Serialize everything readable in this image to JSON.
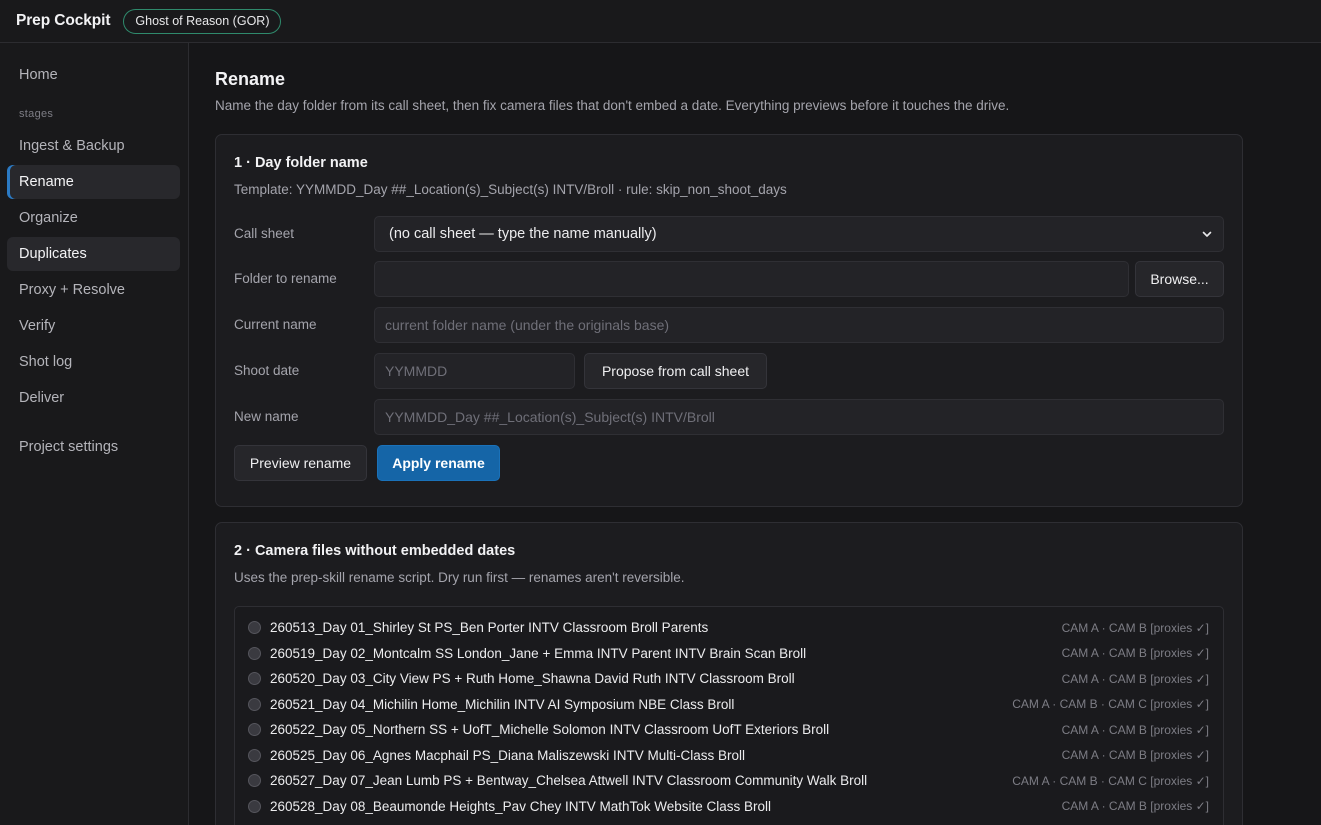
{
  "app": {
    "title": "Prep Cockpit",
    "project": "Ghost of Reason (GOR)"
  },
  "sidebar": {
    "home": "Home",
    "group_label": "stages",
    "items": [
      {
        "label": "Ingest & Backup"
      },
      {
        "label": "Rename"
      },
      {
        "label": "Organize"
      },
      {
        "label": "Duplicates"
      },
      {
        "label": "Proxy + Resolve"
      },
      {
        "label": "Verify"
      },
      {
        "label": "Shot log"
      },
      {
        "label": "Deliver"
      }
    ],
    "settings": "Project settings",
    "active": "Rename"
  },
  "page": {
    "title": "Rename",
    "subtitle": "Name the day folder from its call sheet, then fix camera files that don't embed a date. Everything previews before it touches the drive."
  },
  "day_folder": {
    "title": "1 · Day folder name",
    "template": "Template: YYMMDD_Day ##_Location(s)_Subject(s) INTV/Broll · rule: skip_non_shoot_days",
    "call_sheet_label": "Call sheet",
    "call_sheet_value": "(no call sheet — type the name manually)",
    "folder_label": "Folder to rename",
    "folder_value": "",
    "browse_label": "Browse...",
    "current_label": "Current name",
    "current_placeholder": "current folder name (under the originals base)",
    "shoot_date_label": "Shoot date",
    "shoot_date_placeholder": "YYMMDD",
    "propose_label": "Propose from call sheet",
    "new_name_label": "New name",
    "new_name_placeholder": "YYMMDD_Day ##_Location(s)_Subject(s) INTV/Broll",
    "preview_label": "Preview rename",
    "apply_label": "Apply rename"
  },
  "camera_files": {
    "title": "2 · Camera files without embedded dates",
    "subtitle": "Uses the prep-skill rename script. Dry run first — renames aren't reversible.",
    "folders": [
      {
        "name": "260513_Day 01_Shirley St PS_Ben Porter INTV Classroom Broll Parents",
        "meta": "CAM A · CAM B [proxies ✓]"
      },
      {
        "name": "260519_Day 02_Montcalm SS London_Jane + Emma INTV Parent INTV Brain Scan Broll",
        "meta": "CAM A · CAM B [proxies ✓]"
      },
      {
        "name": "260520_Day 03_City View PS + Ruth Home_Shawna David Ruth INTV Classroom Broll",
        "meta": "CAM A · CAM B [proxies ✓]"
      },
      {
        "name": "260521_Day 04_Michilin Home_Michilin INTV AI Symposium NBE Class Broll",
        "meta": "CAM A · CAM B · CAM C [proxies ✓]"
      },
      {
        "name": "260522_Day 05_Northern SS + UofT_Michelle Solomon INTV Classroom UofT Exteriors Broll",
        "meta": "CAM A · CAM B [proxies ✓]"
      },
      {
        "name": "260525_Day 06_Agnes Macphail PS_Diana Maliszewski INTV Multi-Class Broll",
        "meta": "CAM A · CAM B [proxies ✓]"
      },
      {
        "name": "260527_Day 07_Jean Lumb PS + Bentway_Chelsea Attwell INTV Classroom Community Walk Broll",
        "meta": "CAM A · CAM B · CAM C [proxies ✓]"
      },
      {
        "name": "260528_Day 08_Beaumonde Heights_Pav Chey INTV MathTok Website Class Broll",
        "meta": "CAM A · CAM B [proxies ✓]"
      }
    ]
  },
  "colors": {
    "accent": "#1565a7",
    "active_indicator": "#2b7ac4",
    "pill_border": "#2f8a6c",
    "background": "#161618"
  }
}
